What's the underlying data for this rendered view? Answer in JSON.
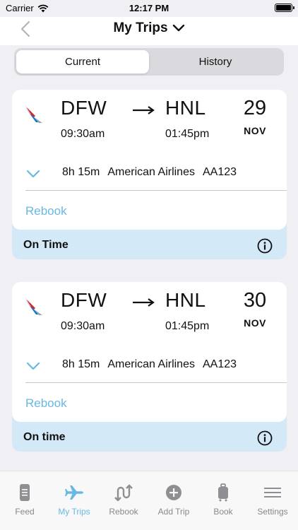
{
  "status_bar": {
    "carrier": "Carrier",
    "time": "12:17 PM"
  },
  "nav": {
    "title": "My Trips"
  },
  "segments": [
    {
      "label": "Current",
      "active": true
    },
    {
      "label": "History",
      "active": false
    }
  ],
  "trips": [
    {
      "from": "DFW",
      "to": "HNL",
      "depart_time": "09:30am",
      "arrive_time": "01:45pm",
      "day": "29",
      "month": "NOV",
      "duration": "8h 15m",
      "airline": "American Airlines",
      "flight": "AA123",
      "action": "Rebook",
      "status": "On Time"
    },
    {
      "from": "DFW",
      "to": "HNL",
      "depart_time": "09:30am",
      "arrive_time": "01:45pm",
      "day": "30",
      "month": "NOV",
      "duration": "8h 15m",
      "airline": "American Airlines",
      "flight": "AA123",
      "action": "Rebook",
      "status": "On time"
    }
  ],
  "tabbar": [
    {
      "label": "Feed",
      "icon": "feed-icon",
      "active": false
    },
    {
      "label": "My Trips",
      "icon": "plane-icon",
      "active": true
    },
    {
      "label": "Rebook",
      "icon": "rebook-icon",
      "active": false
    },
    {
      "label": "Add Trip",
      "icon": "add-icon",
      "active": false
    },
    {
      "label": "Book",
      "icon": "luggage-icon",
      "active": false
    },
    {
      "label": "Settings",
      "icon": "menu-icon",
      "active": false
    }
  ],
  "colors": {
    "accent": "#68b8e4",
    "status_bg": "#d4e9f8",
    "background": "#f0eff4"
  }
}
